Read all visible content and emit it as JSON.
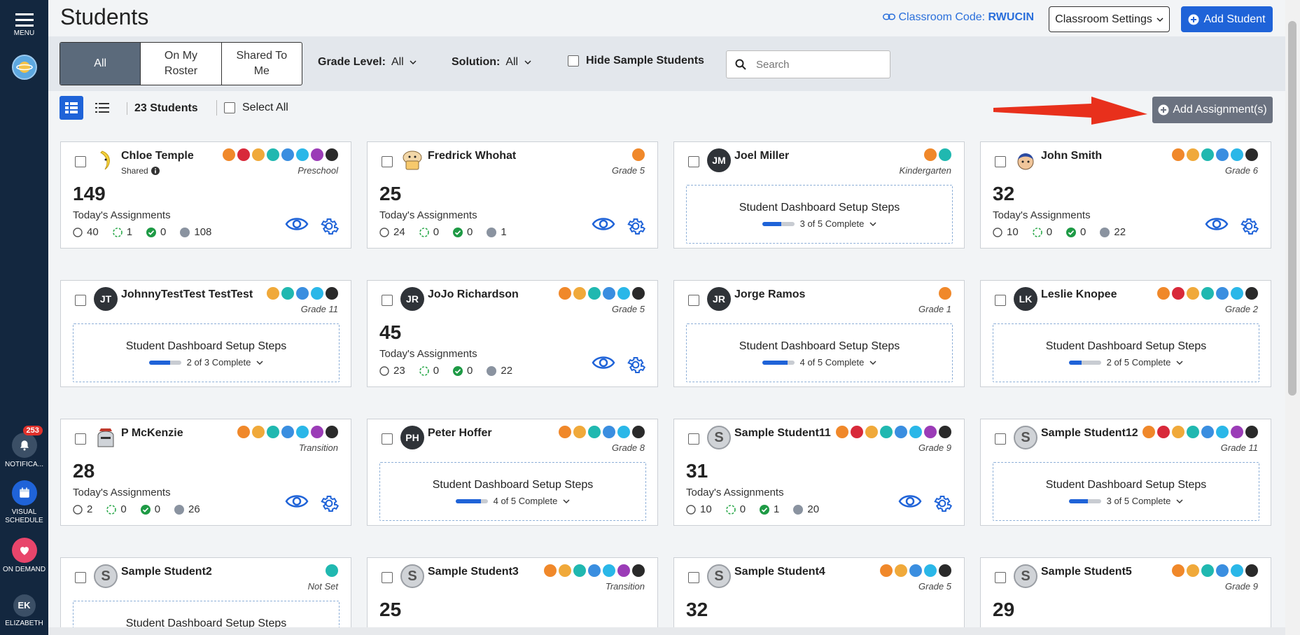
{
  "sidebar": {
    "menu_label": "MENU",
    "notifications_label": "NOTIFICA...",
    "notifications_badge": "253",
    "visual_schedule_label": "VISUAL SCHEDULE",
    "on_demand_label": "ON DEMAND",
    "user_initials": "EK",
    "user_label": "ELIZABETH"
  },
  "header": {
    "title": "Students",
    "classroom_code_label": "Classroom Code:",
    "classroom_code": "RWUCIN",
    "settings_label": "Classroom Settings",
    "add_student_label": "Add Student"
  },
  "filters": {
    "tabs": [
      {
        "label": "All"
      },
      {
        "label": "On My Roster"
      },
      {
        "label": "Shared To Me"
      }
    ],
    "grade_level_label": "Grade Level:",
    "grade_level_value": "All",
    "solution_label": "Solution:",
    "solution_value": "All",
    "hide_sample_label": "Hide Sample Students",
    "search_placeholder": "Search"
  },
  "toolbar": {
    "student_count": "23 Students",
    "select_all_label": "Select All",
    "add_assignments_label": "Add Assignment(s)"
  },
  "colors": {
    "accent": "#1f63d8",
    "sidebar": "#13273f",
    "arrow": "#e8301c"
  },
  "cards": [
    {
      "name": "Chloe Temple",
      "shared": "Shared",
      "avatar": "banana",
      "grade": "Preschool",
      "count": "149",
      "todays": "Today's Assignments",
      "s1": "40",
      "s2": "1",
      "s3": "0",
      "s4": "108",
      "icons": [
        "#f0882a",
        "#d8293a",
        "#f0a93a",
        "#20b8b0",
        "#3a8ee0",
        "#2ab7e8",
        "#9b3cb7",
        "#2a2a2a"
      ]
    },
    {
      "name": "Fredrick Whohat",
      "avatar": "muffin",
      "grade": "Grade 5",
      "count": "25",
      "todays": "Today's Assignments",
      "s1": "24",
      "s2": "0",
      "s3": "0",
      "s4": "1",
      "icons": [
        "#f0882a"
      ]
    },
    {
      "name": "Joel Miller",
      "initials": "JM",
      "grade": "Kindergarten",
      "setup_title": "Student Dashboard Setup Steps",
      "setup_progress": "3 of 5 Complete",
      "setup_fraction": 0.6,
      "icons": [
        "#f0882a",
        "#20b8b0"
      ]
    },
    {
      "name": "John Smith",
      "avatar": "boy",
      "grade": "Grade 6",
      "count": "32",
      "todays": "Today's Assignments",
      "s1": "10",
      "s2": "0",
      "s3": "0",
      "s4": "22",
      "icons": [
        "#f0882a",
        "#f0a93a",
        "#20b8b0",
        "#3a8ee0",
        "#2ab7e8",
        "#2a2a2a"
      ]
    },
    {
      "name": "JohnnyTestTest TestTest",
      "initials": "JT",
      "grade": "Grade 11",
      "setup_title": "Student Dashboard Setup Steps",
      "setup_progress": "2 of 3 Complete",
      "setup_fraction": 0.67,
      "icons": [
        "#f0a93a",
        "#20b8b0",
        "#3a8ee0",
        "#2ab7e8",
        "#2a2a2a"
      ]
    },
    {
      "name": "JoJo Richardson",
      "initials": "JR",
      "grade": "Grade 5",
      "count": "45",
      "todays": "Today's Assignments",
      "s1": "23",
      "s2": "0",
      "s3": "0",
      "s4": "22",
      "icons": [
        "#f0882a",
        "#f0a93a",
        "#20b8b0",
        "#3a8ee0",
        "#2ab7e8",
        "#2a2a2a"
      ]
    },
    {
      "name": "Jorge Ramos",
      "initials": "JR",
      "grade": "Grade 1",
      "setup_title": "Student Dashboard Setup Steps",
      "setup_progress": "4 of 5 Complete",
      "setup_fraction": 0.8,
      "icons": [
        "#f0882a"
      ]
    },
    {
      "name": "Leslie Knopee",
      "initials": "LK",
      "grade": "Grade 2",
      "setup_title": "Student Dashboard Setup Steps",
      "setup_progress": "2 of 5 Complete",
      "setup_fraction": 0.4,
      "icons": [
        "#f0882a",
        "#d8293a",
        "#f0a93a",
        "#20b8b0",
        "#3a8ee0",
        "#2ab7e8",
        "#2a2a2a"
      ]
    },
    {
      "name": "P McKenzie",
      "avatar": "knight",
      "grade": "Transition",
      "count": "28",
      "todays": "Today's Assignments",
      "s1": "2",
      "s2": "0",
      "s3": "0",
      "s4": "26",
      "icons": [
        "#f0882a",
        "#f0a93a",
        "#20b8b0",
        "#3a8ee0",
        "#2ab7e8",
        "#9b3cb7",
        "#2a2a2a"
      ]
    },
    {
      "name": "Peter Hoffer",
      "initials": "PH",
      "grade": "Grade 8",
      "setup_title": "Student Dashboard Setup Steps",
      "setup_progress": "4 of 5 Complete",
      "setup_fraction": 0.8,
      "icons": [
        "#f0882a",
        "#f0a93a",
        "#20b8b0",
        "#3a8ee0",
        "#2ab7e8",
        "#2a2a2a"
      ]
    },
    {
      "name": "Sample Student11",
      "initials": "S",
      "sample": true,
      "grade": "Grade 9",
      "count": "31",
      "todays": "Today's Assignments",
      "s1": "10",
      "s2": "0",
      "s3": "1",
      "s4": "20",
      "icons": [
        "#f0882a",
        "#d8293a",
        "#f0a93a",
        "#20b8b0",
        "#3a8ee0",
        "#2ab7e8",
        "#9b3cb7",
        "#2a2a2a"
      ]
    },
    {
      "name": "Sample Student12",
      "initials": "S",
      "sample": true,
      "grade": "Grade 11",
      "setup_title": "Student Dashboard Setup Steps",
      "setup_progress": "3 of 5 Complete",
      "setup_fraction": 0.6,
      "icons": [
        "#f0882a",
        "#d8293a",
        "#f0a93a",
        "#20b8b0",
        "#3a8ee0",
        "#2ab7e8",
        "#9b3cb7",
        "#2a2a2a"
      ]
    },
    {
      "name": "Sample Student2",
      "initials": "S",
      "sample": true,
      "grade": "Not Set",
      "setup_title": "Student Dashboard Setup Steps",
      "setup_progress": "",
      "setup_fraction": 0,
      "icons": [
        "#20b8b0"
      ]
    },
    {
      "name": "Sample Student3",
      "initials": "S",
      "sample": true,
      "grade": "Transition",
      "count": "25",
      "icons": [
        "#f0882a",
        "#f0a93a",
        "#20b8b0",
        "#3a8ee0",
        "#2ab7e8",
        "#9b3cb7",
        "#2a2a2a"
      ]
    },
    {
      "name": "Sample Student4",
      "initials": "S",
      "sample": true,
      "grade": "Grade 5",
      "count": "32",
      "icons": [
        "#f0882a",
        "#f0a93a",
        "#3a8ee0",
        "#2ab7e8",
        "#2a2a2a"
      ]
    },
    {
      "name": "Sample Student5",
      "initials": "S",
      "sample": true,
      "grade": "Grade 9",
      "count": "29",
      "icons": [
        "#f0882a",
        "#f0a93a",
        "#20b8b0",
        "#3a8ee0",
        "#2ab7e8",
        "#2a2a2a"
      ]
    }
  ]
}
